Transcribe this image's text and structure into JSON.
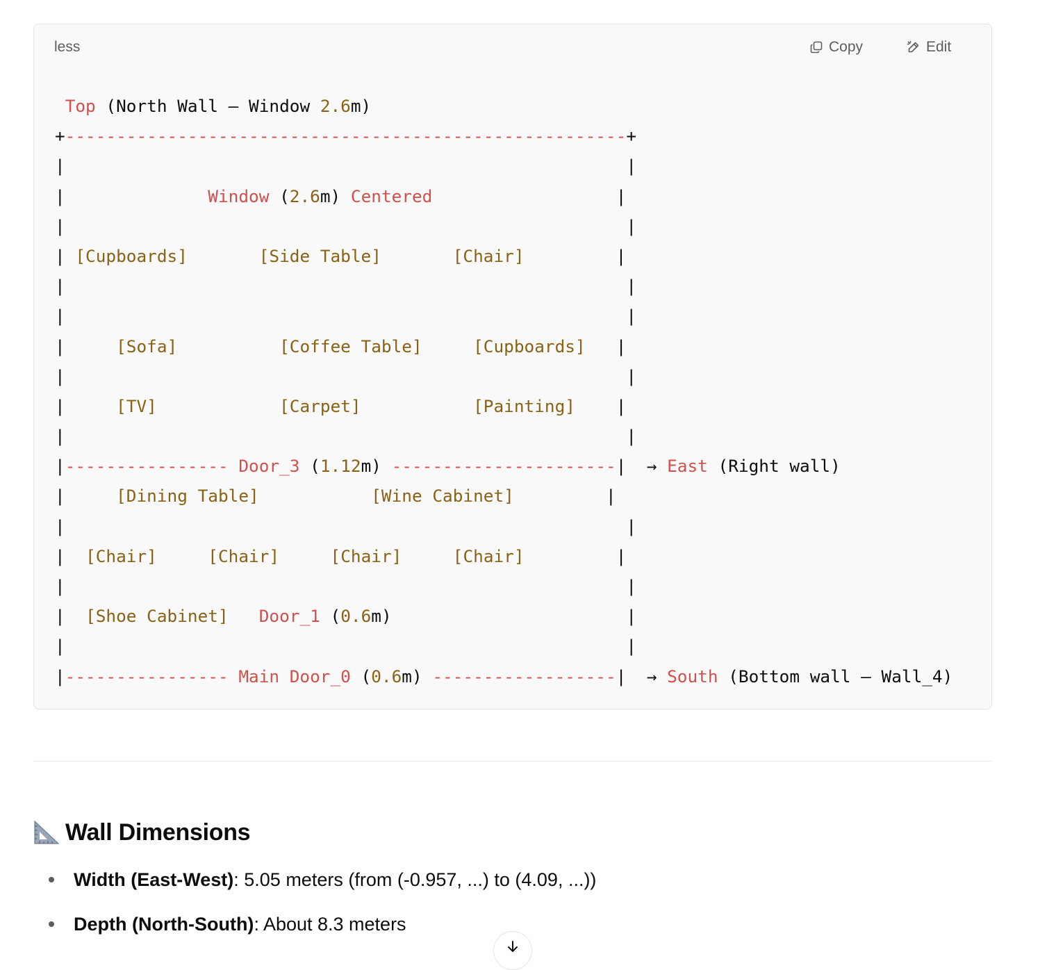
{
  "code_block": {
    "language": "less",
    "copy_label": "Copy",
    "edit_label": "Edit",
    "lines": [
      [
        [
          "op",
          " "
        ],
        [
          "kw",
          "Top"
        ],
        [
          "op",
          " (North Wall – Window "
        ],
        [
          "num",
          "2.6"
        ],
        [
          "op",
          "m)"
        ]
      ],
      [
        [
          "op",
          "+"
        ],
        [
          "dash",
          "-------------------------------------------------------"
        ],
        [
          "op",
          "+"
        ]
      ],
      [
        [
          "op",
          "|                                                       |"
        ]
      ],
      [
        [
          "op",
          "|              "
        ],
        [
          "kw",
          "Window"
        ],
        [
          "op",
          " ("
        ],
        [
          "num",
          "2.6"
        ],
        [
          "op",
          "m) "
        ],
        [
          "kw",
          "Centered"
        ],
        [
          "op",
          "                  |"
        ]
      ],
      [
        [
          "op",
          "|                                                       |"
        ]
      ],
      [
        [
          "op",
          "| "
        ],
        [
          "br",
          "[Cupboards]"
        ],
        [
          "op",
          "       "
        ],
        [
          "br",
          "[Side Table]"
        ],
        [
          "op",
          "       "
        ],
        [
          "br",
          "[Chair]"
        ],
        [
          "op",
          "         |"
        ]
      ],
      [
        [
          "op",
          "|                                                       |"
        ]
      ],
      [
        [
          "op",
          "|                                                       |"
        ]
      ],
      [
        [
          "op",
          "|     "
        ],
        [
          "br",
          "[Sofa]"
        ],
        [
          "op",
          "          "
        ],
        [
          "br",
          "[Coffee Table]"
        ],
        [
          "op",
          "     "
        ],
        [
          "br",
          "[Cupboards]"
        ],
        [
          "op",
          "   |"
        ]
      ],
      [
        [
          "op",
          "|                                                       |"
        ]
      ],
      [
        [
          "op",
          "|     "
        ],
        [
          "br",
          "[TV]"
        ],
        [
          "op",
          "            "
        ],
        [
          "br",
          "[Carpet]"
        ],
        [
          "op",
          "           "
        ],
        [
          "br",
          "[Painting]"
        ],
        [
          "op",
          "    |"
        ]
      ],
      [
        [
          "op",
          "|                                                       |"
        ]
      ],
      [
        [
          "op",
          "|"
        ],
        [
          "dash",
          "----------------"
        ],
        [
          "op",
          " "
        ],
        [
          "kw",
          "Door_3"
        ],
        [
          "op",
          " ("
        ],
        [
          "num",
          "1.12"
        ],
        [
          "op",
          "m) "
        ],
        [
          "dash",
          "----------------------"
        ],
        [
          "op",
          "|  → "
        ],
        [
          "kw",
          "East"
        ],
        [
          "op",
          " (Right wall)"
        ]
      ],
      [
        [
          "op",
          "|     "
        ],
        [
          "br",
          "[Dining Table]"
        ],
        [
          "op",
          "           "
        ],
        [
          "br",
          "[Wine Cabinet]"
        ],
        [
          "op",
          "         |"
        ]
      ],
      [
        [
          "op",
          "|                                                       |"
        ]
      ],
      [
        [
          "op",
          "|  "
        ],
        [
          "br",
          "[Chair]"
        ],
        [
          "op",
          "     "
        ],
        [
          "br",
          "[Chair]"
        ],
        [
          "op",
          "     "
        ],
        [
          "br",
          "[Chair]"
        ],
        [
          "op",
          "     "
        ],
        [
          "br",
          "[Chair]"
        ],
        [
          "op",
          "         |"
        ]
      ],
      [
        [
          "op",
          "|                                                       |"
        ]
      ],
      [
        [
          "op",
          "|  "
        ],
        [
          "br",
          "[Shoe Cabinet]"
        ],
        [
          "op",
          "   "
        ],
        [
          "kw",
          "Door_1"
        ],
        [
          "op",
          " ("
        ],
        [
          "num",
          "0.6"
        ],
        [
          "op",
          "m)                       |"
        ]
      ],
      [
        [
          "op",
          "|                                                       |"
        ]
      ],
      [
        [
          "op",
          "|"
        ],
        [
          "dash",
          "----------------"
        ],
        [
          "op",
          " "
        ],
        [
          "kw",
          "Main Door_0"
        ],
        [
          "op",
          " ("
        ],
        [
          "num",
          "0.6"
        ],
        [
          "op",
          "m) "
        ],
        [
          "dash",
          "------------------"
        ],
        [
          "op",
          "|  → "
        ],
        [
          "kw",
          "South"
        ],
        [
          "op",
          " (Bottom wall – Wall_4)"
        ]
      ]
    ]
  },
  "section": {
    "icon": "triangular-ruler-icon",
    "title": "Wall Dimensions"
  },
  "bullets": [
    {
      "label": "Width (East-West)",
      "text": ": 5.05 meters (from (-0.957, ...) to (4.09, ...))"
    },
    {
      "label": "Depth (North-South)",
      "text": ": About 8.3 meters"
    }
  ],
  "colors": {
    "keyword": "#d1504d",
    "number": "#8a6216",
    "bracket": "#8a6216",
    "text": "#0d0d0d"
  }
}
